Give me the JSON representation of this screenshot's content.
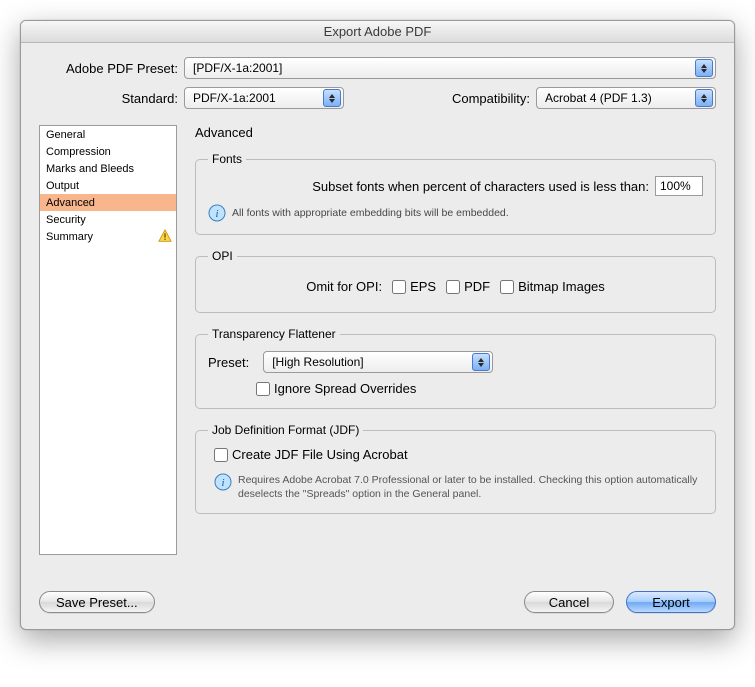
{
  "window_title": "Export Adobe PDF",
  "preset": {
    "label": "Adobe PDF Preset:",
    "value": "[PDF/X-1a:2001]"
  },
  "standard": {
    "label": "Standard:",
    "value": "PDF/X-1a:2001"
  },
  "compatibility": {
    "label": "Compatibility:",
    "value": "Acrobat 4 (PDF 1.3)"
  },
  "sidebar": {
    "items": [
      "General",
      "Compression",
      "Marks and Bleeds",
      "Output",
      "Advanced",
      "Security",
      "Summary"
    ],
    "selected_index": 4,
    "warning_index": 6
  },
  "panel": {
    "title": "Advanced",
    "fonts": {
      "legend": "Fonts",
      "subset_label": "Subset fonts when percent of characters used is less than:",
      "subset_value": "100%",
      "info": "All fonts with appropriate embedding bits will be embedded."
    },
    "opi": {
      "legend": "OPI",
      "label": "Omit for OPI:",
      "eps": "EPS",
      "pdf": "PDF",
      "bitmap": "Bitmap Images"
    },
    "flattener": {
      "legend": "Transparency Flattener",
      "preset_label": "Preset:",
      "preset_value": "[High Resolution]",
      "ignore_label": "Ignore Spread Overrides"
    },
    "jdf": {
      "legend": "Job Definition Format (JDF)",
      "create_label": "Create JDF File Using Acrobat",
      "info": "Requires Adobe Acrobat 7.0 Professional or later to be installed. Checking this option automatically deselects the \"Spreads\" option in the General panel."
    }
  },
  "buttons": {
    "save_preset": "Save Preset...",
    "cancel": "Cancel",
    "export": "Export"
  }
}
